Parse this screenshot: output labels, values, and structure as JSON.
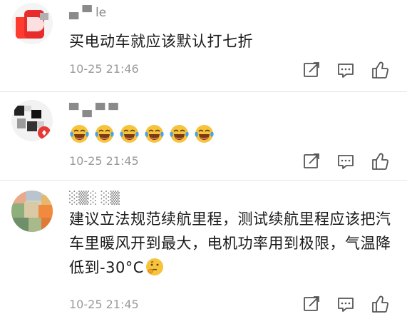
{
  "comments": [
    {
      "username": "▄ ▀ le",
      "text": "买电动车就应该默认打七折",
      "time": "10-25 21:46",
      "avatar_icon": "red-logo-avatar-icon"
    },
    {
      "username": "▀ ▄ ▀ ▀",
      "emoji_icon": "tears-of-joy-emoji-icon",
      "emoji_count": 6,
      "time": "10-25 21:45",
      "avatar_icon": "pixelated-avatar-icon"
    },
    {
      "username": "░▒░ ░▒",
      "text": "建议立法规范续航里程，测试续航里程应该把汽车里暖风开到最大，电机功率用到极限，气温降低到-30°C",
      "trailing_emoji_icon": "thinking-face-emoji-icon",
      "time": "10-25 21:45",
      "avatar_icon": "pixelated-landscape-avatar-icon"
    }
  ],
  "action_icons": [
    "share-icon",
    "reply-icon",
    "like-icon"
  ],
  "colors": {
    "text": "#1a1a1a",
    "meta": "#9a9a9a",
    "divider": "#e6e6e6",
    "icon": "#555555",
    "emoji_face": "#f6c33b"
  }
}
